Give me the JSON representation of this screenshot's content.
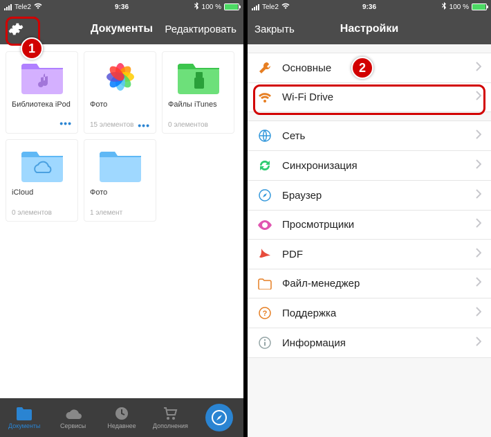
{
  "status": {
    "carrier": "Tele2",
    "time": "9:36",
    "battery_pct": "100 %"
  },
  "left": {
    "title": "Документы",
    "edit": "Редактировать",
    "tiles": [
      {
        "name": "Библиотека iPod",
        "meta": "",
        "more": true
      },
      {
        "name": "Фото",
        "meta": "15 элементов",
        "more": true
      },
      {
        "name": "Файлы iTunes",
        "meta": "0 элементов",
        "more": false
      },
      {
        "name": "iCloud",
        "meta": "0 элементов",
        "more": false
      },
      {
        "name": "Фото",
        "meta": "1 элемент",
        "more": false
      }
    ],
    "tabs": [
      {
        "label": "Документы"
      },
      {
        "label": "Сервисы"
      },
      {
        "label": "Недавнее"
      },
      {
        "label": "Дополнения"
      },
      {
        "label": ""
      }
    ]
  },
  "right": {
    "close": "Закрыть",
    "title": "Настройки",
    "rows_a": [
      {
        "label": "Основные",
        "icon": "wrench",
        "color": "#e67e22"
      },
      {
        "label": "Wi-Fi Drive",
        "icon": "wifi",
        "color": "#e67e22"
      }
    ],
    "rows_b": [
      {
        "label": "Сеть",
        "icon": "globe",
        "color": "#3498db"
      },
      {
        "label": "Синхронизация",
        "icon": "sync",
        "color": "#2ecc71"
      },
      {
        "label": "Браузер",
        "icon": "compass",
        "color": "#3498db"
      },
      {
        "label": "Просмотрщики",
        "icon": "eye",
        "color": "#e056b0"
      },
      {
        "label": "PDF",
        "icon": "pdf",
        "color": "#e74c3c"
      },
      {
        "label": "Файл-менеджер",
        "icon": "folder",
        "color": "#e67e22"
      },
      {
        "label": "Поддержка",
        "icon": "help",
        "color": "#e67e22"
      },
      {
        "label": "Информация",
        "icon": "info",
        "color": "#95a5a6"
      }
    ]
  },
  "callouts": {
    "one": "1",
    "two": "2"
  }
}
